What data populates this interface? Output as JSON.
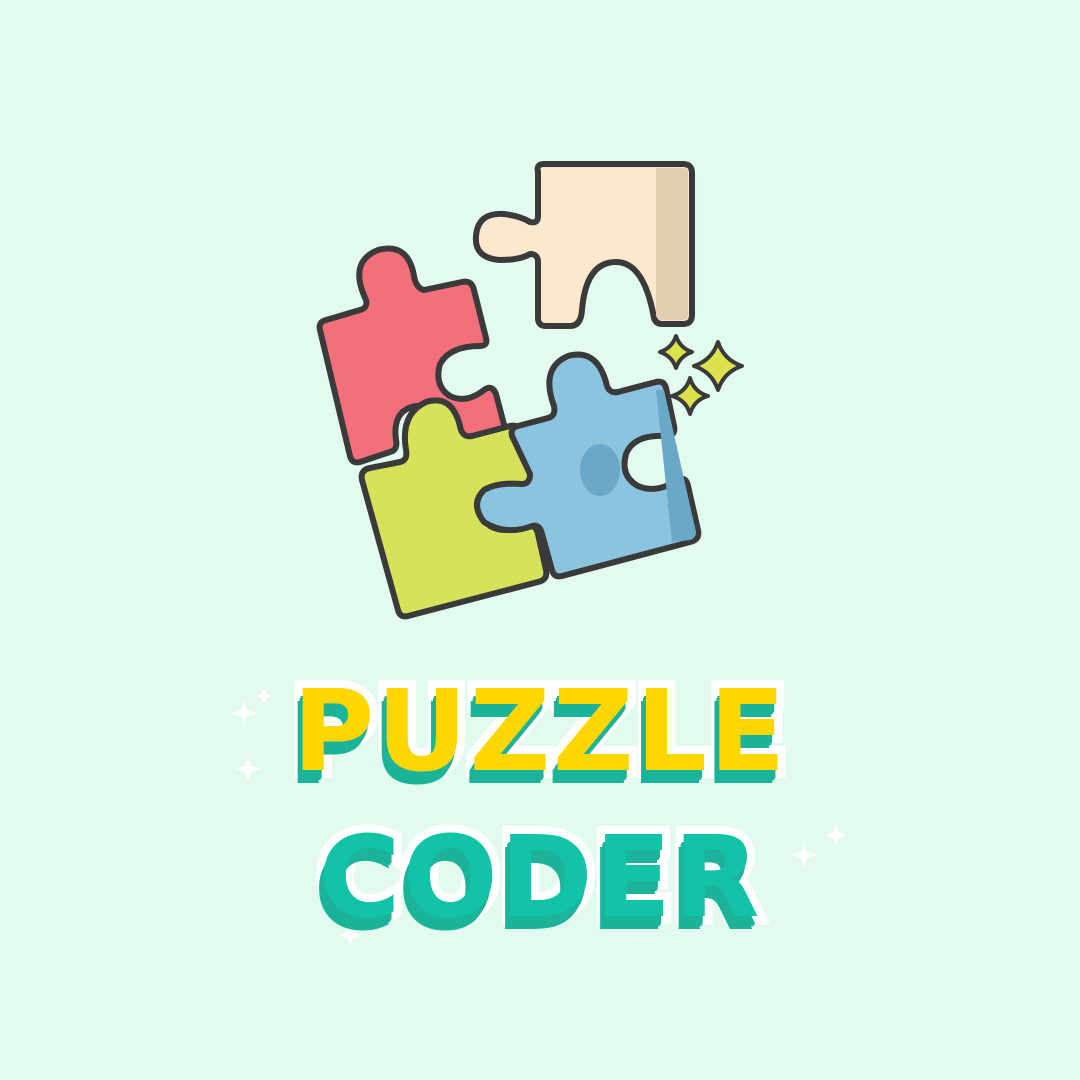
{
  "theme": {
    "background": "#e3fbee",
    "outline": "#3a3a3a",
    "piece_red": "#f26f7b",
    "piece_cream": "#fbe8cf",
    "piece_cream_shade": "#e2ceae",
    "piece_lime": "#d6e25a",
    "piece_blue": "#8cc4e0",
    "piece_blue_shade": "#6aa8c8",
    "sparkle_yellow": "#dbe24e",
    "title_primary": "#ffd700",
    "title_secondary": "#12c3a8",
    "title_shadow": "#1bb39a",
    "title_outline": "#ffffff"
  },
  "logo": {
    "icon": "puzzle-pieces-icon",
    "sparkle_icon": "sparkle-icon"
  },
  "title": {
    "line1": "PUZZLE",
    "line2": "CODER"
  }
}
